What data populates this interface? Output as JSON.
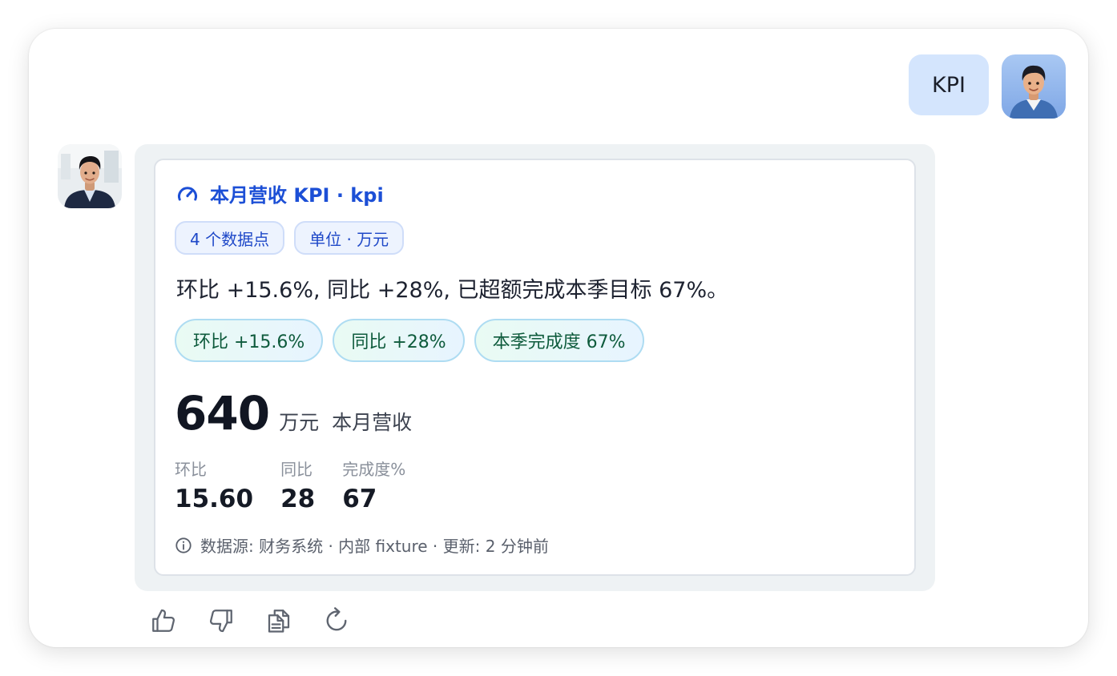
{
  "user_message": {
    "text": "KPI"
  },
  "card": {
    "title": "本月营收 KPI · kpi",
    "chips": [
      "4 个数据点",
      "单位 · 万元"
    ],
    "summary": "环比 +15.6%, 同比 +28%, 已超额完成本季目标 67%。",
    "stat_chips": [
      "环比 +15.6%",
      "同比 +28%",
      "本季完成度 67%"
    ],
    "main_value": "640",
    "main_unit": "万元",
    "main_label": "本月营收",
    "metrics": [
      {
        "label": "环比",
        "value": "15.60"
      },
      {
        "label": "同比",
        "value": "28"
      },
      {
        "label": "完成度%",
        "value": "67"
      }
    ],
    "footnote": "数据源: 财务系统 · 内部 fixture · 更新: 2 分钟前"
  },
  "icons": {
    "title": "gauge-icon",
    "footnote": "info-icon",
    "actions": [
      "thumbs-up-icon",
      "thumbs-down-icon",
      "copy-icon",
      "regenerate-icon"
    ]
  },
  "colors": {
    "accent": "#1c4fd6",
    "user_bubble": "#d4e5fd",
    "stat_chip_text": "#0e5b3c",
    "message_background": "#eef2f4"
  }
}
